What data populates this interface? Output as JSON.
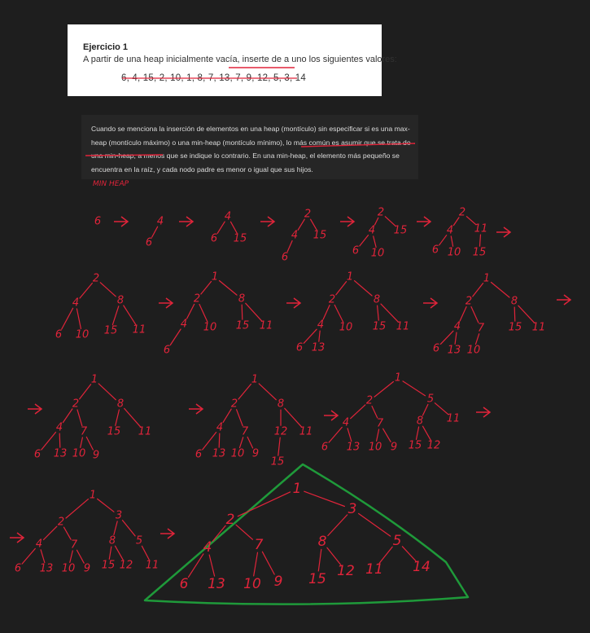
{
  "exercise": {
    "title": "Ejercicio 1",
    "prompt": "A partir de una heap inicialmente vacía, inserte de a uno los siguientes valores:",
    "values_line": "6, 4, 15, 2, 10, 1, 8, 7, 13, 7, 9, 12, 5, 3, 14"
  },
  "note": {
    "text": "Cuando se menciona la inserción de elementos en una heap (montículo) sin especificar si es una max-heap (montículo máximo) o una min-heap (montículo mínimo), lo más común es asumir que se trata de una min-heap, a menos que se indique lo contrario. En una min-heap, el elemento más pequeño se encuentra en la raíz, y cada nodo padre es menor o igual que sus hijos."
  },
  "annotation": {
    "heap_type": "MIN HEAP"
  },
  "colors": {
    "ink": "#e0243a",
    "highlight": "#1f9a3a",
    "background": "#1e1e1e"
  },
  "steps": [
    {
      "id": "s1",
      "labels": [
        "6"
      ]
    },
    {
      "id": "s2",
      "labels": [
        "4",
        "6"
      ]
    },
    {
      "id": "s3",
      "labels": [
        "4",
        "6",
        "15"
      ]
    },
    {
      "id": "s4",
      "labels": [
        "2",
        "4",
        "15",
        "6"
      ]
    },
    {
      "id": "s5",
      "labels": [
        "2",
        "4",
        "15",
        "6",
        "10"
      ]
    },
    {
      "id": "s6",
      "labels": [
        "2",
        "4",
        "11",
        "6",
        "10",
        "15"
      ]
    },
    {
      "id": "s7",
      "labels": [
        "2",
        "4",
        "8",
        "6",
        "10",
        "15",
        "11"
      ]
    },
    {
      "id": "s8",
      "labels": [
        "1",
        "2",
        "8",
        "4",
        "10",
        "15",
        "11",
        "6"
      ]
    },
    {
      "id": "s9",
      "labels": [
        "1",
        "2",
        "8",
        "4",
        "10",
        "15",
        "11",
        "6",
        "13"
      ]
    },
    {
      "id": "s10",
      "labels": [
        "1",
        "2",
        "8",
        "4",
        "7",
        "15",
        "11",
        "6",
        "13",
        "10"
      ]
    },
    {
      "id": "s11",
      "labels": [
        "1",
        "2",
        "8",
        "4",
        "7",
        "15",
        "11",
        "6",
        "13",
        "10",
        "9"
      ]
    },
    {
      "id": "s12",
      "labels": [
        "1",
        "2",
        "8",
        "4",
        "7",
        "12",
        "11",
        "6",
        "13",
        "10",
        "9",
        "15"
      ]
    },
    {
      "id": "s13",
      "labels": [
        "1",
        "2",
        "5",
        "4",
        "7",
        "8",
        "11",
        "6",
        "13",
        "10",
        "9",
        "15",
        "12"
      ]
    },
    {
      "id": "s14",
      "labels": [
        "1",
        "2",
        "3",
        "4",
        "7",
        "8",
        "5",
        "6",
        "13",
        "10",
        "9",
        "15",
        "12",
        "11"
      ]
    },
    {
      "id": "s15",
      "labels": [
        "1",
        "2",
        "3",
        "4",
        "7",
        "8",
        "5",
        "6",
        "13",
        "10",
        "9",
        "15",
        "12",
        "11",
        "14"
      ]
    }
  ]
}
